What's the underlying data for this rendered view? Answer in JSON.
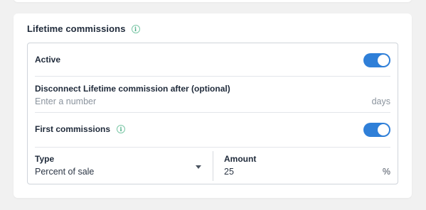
{
  "section": {
    "title": "Lifetime commissions",
    "info_icon": "info-icon"
  },
  "active": {
    "label": "Active",
    "enabled": true
  },
  "disconnect": {
    "label": "Disconnect Lifetime commission after (optional)",
    "placeholder": "Enter a number",
    "value": "",
    "unit": "days"
  },
  "first_commissions": {
    "label": "First commissions",
    "info_icon": "info-icon",
    "enabled": true
  },
  "type": {
    "label": "Type",
    "selected": "Percent of sale",
    "dropdown_icon": "caret-down-icon"
  },
  "amount": {
    "label": "Amount",
    "value": "25",
    "unit": "%"
  },
  "colors": {
    "toggle_on": "#2f7fd8",
    "info_icon": "#4cae86",
    "background": "#f1f1f1",
    "card": "#ffffff"
  }
}
